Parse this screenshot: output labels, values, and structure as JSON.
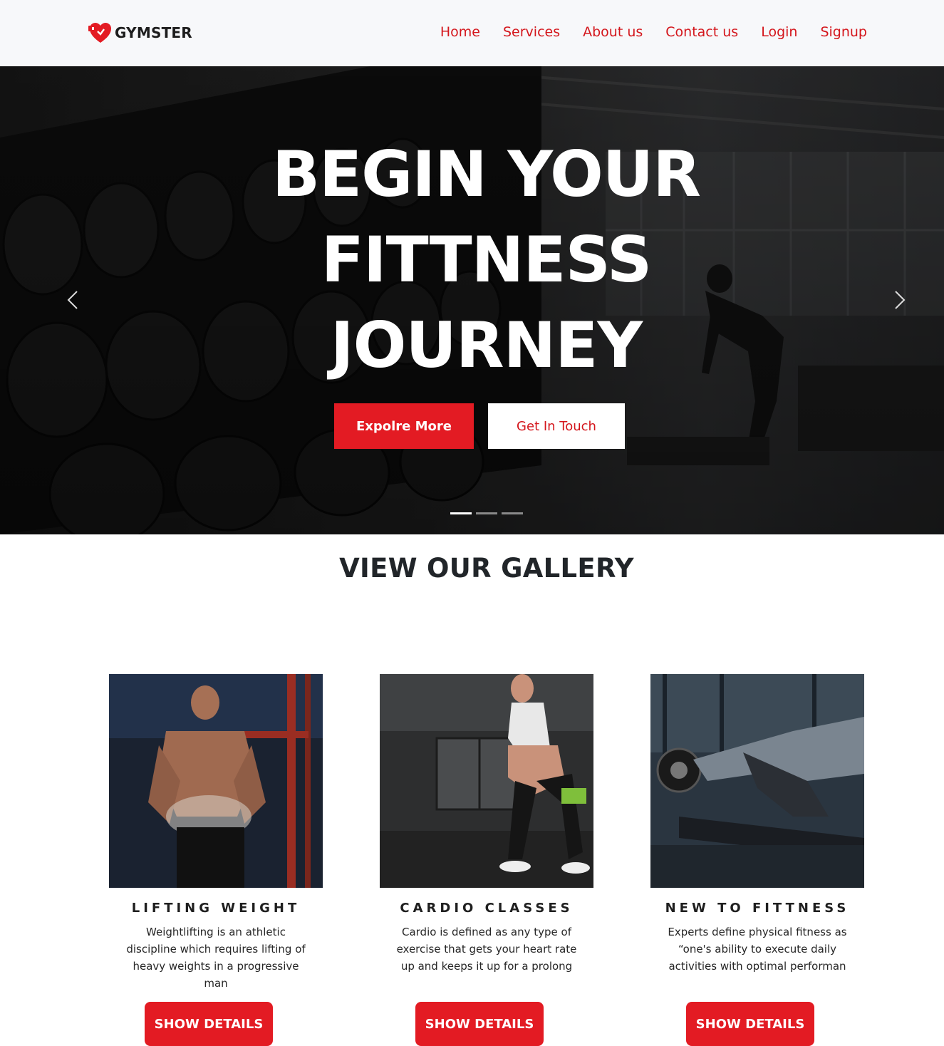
{
  "brand": {
    "name": "GYMSTER",
    "logo_icon": "heart-dumbbell-icon",
    "accent": "#e31b23"
  },
  "nav": {
    "items": [
      {
        "label": "Home"
      },
      {
        "label": "Services"
      },
      {
        "label": "About us"
      },
      {
        "label": "Contact us"
      },
      {
        "label": "Login"
      },
      {
        "label": "Signup"
      }
    ],
    "link_color": "#d4161c"
  },
  "hero": {
    "title_lines": [
      "BEGIN YOUR",
      "FITTNESS",
      "JOURNEY"
    ],
    "primary_button": "Expolre More",
    "secondary_button": "Get In Touch",
    "prev_icon": "chevron-left-icon",
    "next_icon": "chevron-right-icon",
    "slides": 3,
    "active_slide": 1
  },
  "gallery": {
    "title": "VIEW OUR GALLERY",
    "cards": [
      {
        "title": "LIFTING WEIGHT",
        "text": "Weightlifting is an athletic discipline which requires lifting of heavy weights in a progressive man",
        "button": "SHOW DETAILS"
      },
      {
        "title": "CARDIO CLASSES",
        "text": "Cardio is defined as any type of exercise that gets your heart rate up and keeps it up for a prolong",
        "button": "SHOW DETAILS"
      },
      {
        "title": "NEW TO FITTNESS",
        "text": "Experts define physical fitness as “one's ability to execute daily activities with optimal performan",
        "button": "SHOW DETAILS"
      }
    ]
  }
}
